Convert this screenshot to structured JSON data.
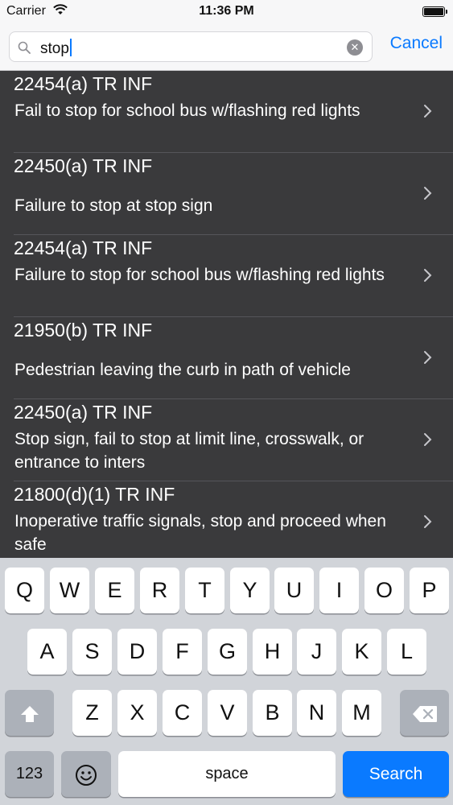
{
  "status_bar": {
    "carrier": "Carrier",
    "time": "11:36 PM",
    "battery_level": 1.0,
    "wifi_icon": "wifi-icon"
  },
  "search": {
    "query": "stop",
    "cancel_label": "Cancel",
    "search_icon": "magnifier-icon",
    "clear_icon": "clear-circle-icon"
  },
  "colors": {
    "accent": "#0a7aff",
    "list_background": "#3a3a3c",
    "keyboard_background": "#d1d4d9"
  },
  "results": [
    {
      "code": "22454(a) TR INF",
      "description": "Fail to stop for school bus w/flashing red lights"
    },
    {
      "code": "22450(a) TR INF",
      "description": "Failure to stop at stop sign"
    },
    {
      "code": "22454(a) TR INF",
      "description": "Failure to stop for school bus w/flashing red lights"
    },
    {
      "code": "21950(b) TR INF",
      "description": "Pedestrian leaving the curb in path of vehicle"
    },
    {
      "code": "22450(a) TR INF",
      "description": "Stop sign, fail to stop at limit line, crosswalk, or entrance to inters"
    },
    {
      "code": "21800(d)(1) TR INF",
      "description": "Inoperative traffic signals, stop and proceed when safe"
    }
  ],
  "keyboard": {
    "row1": [
      "Q",
      "W",
      "E",
      "R",
      "T",
      "Y",
      "U",
      "I",
      "O",
      "P"
    ],
    "row2": [
      "A",
      "S",
      "D",
      "F",
      "G",
      "H",
      "J",
      "K",
      "L"
    ],
    "row3": [
      "Z",
      "X",
      "C",
      "V",
      "B",
      "N",
      "M"
    ],
    "numbers_label": "123",
    "space_label": "space",
    "search_label": "Search",
    "shift_icon": "shift-arrow-icon",
    "delete_icon": "backspace-icon",
    "emoji_icon": "emoji-icon"
  }
}
